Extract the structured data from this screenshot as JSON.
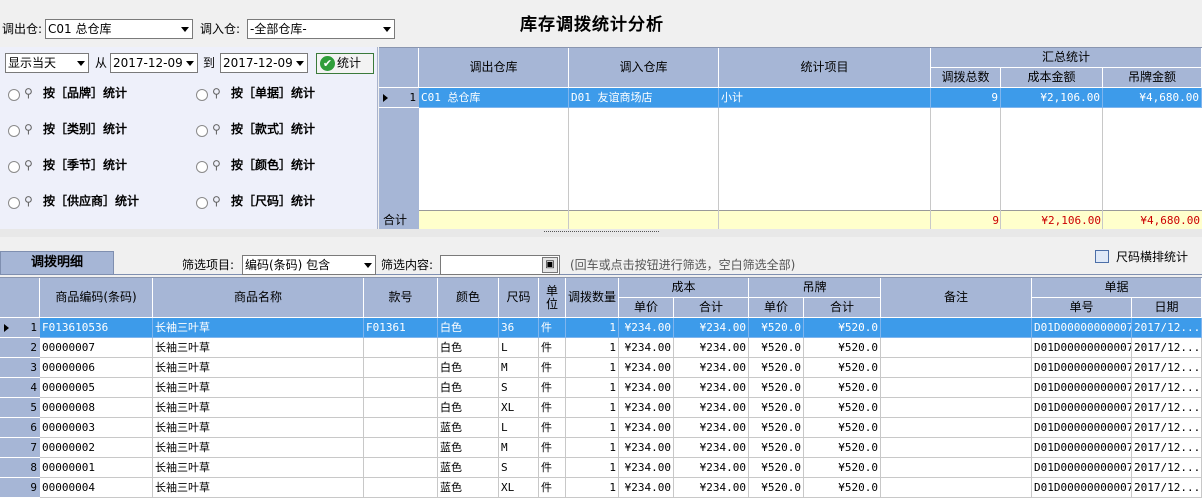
{
  "header": {
    "out_wh_label": "调出仓:",
    "out_wh_value": "C01 总仓库",
    "in_wh_label": "调入仓:",
    "in_wh_value": "-全部仓库-",
    "title": "库存调拨统计分析"
  },
  "filter": {
    "period_value": "显示当天",
    "from_label": "从",
    "from_date": "2017-12-09",
    "to_label": "到",
    "to_date": "2017-12-09",
    "stat_button": "统计",
    "options": [
      "按［品牌］统计",
      "按［单据］统计",
      "按［类别］统计",
      "按［款式］统计",
      "按［季节］统计",
      "按［颜色］统计",
      "按［供应商］统计",
      "按［尺码］统计"
    ]
  },
  "summary_table": {
    "headers": {
      "out_wh": "调出仓库",
      "in_wh": "调入仓库",
      "item": "统计项目",
      "group": "汇总统计",
      "qty": "调拨总数",
      "cost": "成本金额",
      "tag": "吊牌金额"
    },
    "rows": [
      {
        "no": "1",
        "out_wh": "C01 总仓库",
        "in_wh": "D01 友谊商场店",
        "item": "小计",
        "qty": "9",
        "cost": "¥2,106.00",
        "tag": "¥4,680.00"
      }
    ],
    "total_label": "合计",
    "total_qty": "9",
    "total_cost": "¥2,106.00",
    "total_tag": "¥4,680.00"
  },
  "detail": {
    "tab_label": "调拨明细",
    "filter_item_label": "筛选项目:",
    "filter_item_value": "编码(条码) 包含",
    "filter_content_label": "筛选内容:",
    "filter_content_value": "",
    "hint": "(回车或点击按钮进行筛选，空白筛选全部)",
    "size_stat_label": "尺码横排统计",
    "headers": {
      "code": "商品编码(条码)",
      "name": "商品名称",
      "style": "款号",
      "color": "颜色",
      "size": "尺码",
      "unit": "单位",
      "qty": "调拨数量",
      "cost": "成本",
      "cost_price": "单价",
      "cost_total": "合计",
      "tag": "吊牌",
      "tag_price": "单价",
      "tag_total": "合计",
      "remark": "备注",
      "doc": "单据",
      "doc_no": "单号",
      "doc_date": "日期"
    },
    "rows": [
      {
        "no": "1",
        "code": "F013610536",
        "name": "长袖三叶草",
        "style": "F01361",
        "color": "白色",
        "size": "36",
        "unit": "件",
        "qty": "1",
        "cp": "¥234.00",
        "ct": "¥234.00",
        "tp": "¥520.0",
        "tt": "¥520.0",
        "remark": "",
        "doc": "D01D00000000007",
        "date": "2017/12..."
      },
      {
        "no": "2",
        "code": "00000007",
        "name": "长袖三叶草",
        "style": "",
        "color": "白色",
        "size": "L",
        "unit": "件",
        "qty": "1",
        "cp": "¥234.00",
        "ct": "¥234.00",
        "tp": "¥520.0",
        "tt": "¥520.0",
        "remark": "",
        "doc": "D01D00000000007",
        "date": "2017/12..."
      },
      {
        "no": "3",
        "code": "00000006",
        "name": "长袖三叶草",
        "style": "",
        "color": "白色",
        "size": "M",
        "unit": "件",
        "qty": "1",
        "cp": "¥234.00",
        "ct": "¥234.00",
        "tp": "¥520.0",
        "tt": "¥520.0",
        "remark": "",
        "doc": "D01D00000000007",
        "date": "2017/12..."
      },
      {
        "no": "4",
        "code": "00000005",
        "name": "长袖三叶草",
        "style": "",
        "color": "白色",
        "size": "S",
        "unit": "件",
        "qty": "1",
        "cp": "¥234.00",
        "ct": "¥234.00",
        "tp": "¥520.0",
        "tt": "¥520.0",
        "remark": "",
        "doc": "D01D00000000007",
        "date": "2017/12..."
      },
      {
        "no": "5",
        "code": "00000008",
        "name": "长袖三叶草",
        "style": "",
        "color": "白色",
        "size": "XL",
        "unit": "件",
        "qty": "1",
        "cp": "¥234.00",
        "ct": "¥234.00",
        "tp": "¥520.0",
        "tt": "¥520.0",
        "remark": "",
        "doc": "D01D00000000007",
        "date": "2017/12..."
      },
      {
        "no": "6",
        "code": "00000003",
        "name": "长袖三叶草",
        "style": "",
        "color": "蓝色",
        "size": "L",
        "unit": "件",
        "qty": "1",
        "cp": "¥234.00",
        "ct": "¥234.00",
        "tp": "¥520.0",
        "tt": "¥520.0",
        "remark": "",
        "doc": "D01D00000000007",
        "date": "2017/12..."
      },
      {
        "no": "7",
        "code": "00000002",
        "name": "长袖三叶草",
        "style": "",
        "color": "蓝色",
        "size": "M",
        "unit": "件",
        "qty": "1",
        "cp": "¥234.00",
        "ct": "¥234.00",
        "tp": "¥520.0",
        "tt": "¥520.0",
        "remark": "",
        "doc": "D01D00000000007",
        "date": "2017/12..."
      },
      {
        "no": "8",
        "code": "00000001",
        "name": "长袖三叶草",
        "style": "",
        "color": "蓝色",
        "size": "S",
        "unit": "件",
        "qty": "1",
        "cp": "¥234.00",
        "ct": "¥234.00",
        "tp": "¥520.0",
        "tt": "¥520.0",
        "remark": "",
        "doc": "D01D00000000007",
        "date": "2017/12..."
      },
      {
        "no": "9",
        "code": "00000004",
        "name": "长袖三叶草",
        "style": "",
        "color": "蓝色",
        "size": "XL",
        "unit": "件",
        "qty": "1",
        "cp": "¥234.00",
        "ct": "¥234.00",
        "tp": "¥520.0",
        "tt": "¥520.0",
        "remark": "",
        "doc": "D01D00000000007",
        "date": "2017/12..."
      }
    ]
  },
  "colors": {
    "selected_row": "#3d9bea",
    "header_bg": "#a6b6d6",
    "total_bg": "#ffffcc",
    "total_text": "#cc0000"
  }
}
